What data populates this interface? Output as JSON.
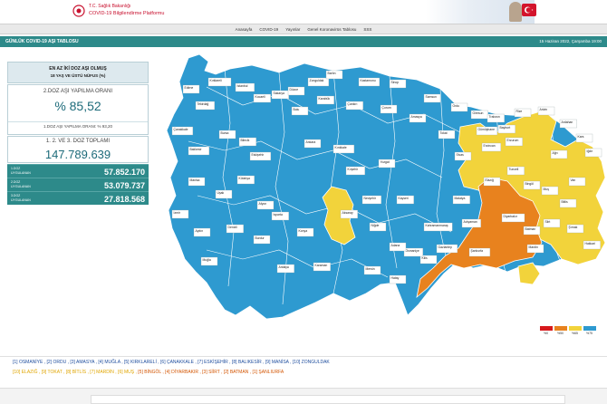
{
  "header": {
    "org_line1": "T.C. Sağlık Bakanlığı",
    "org_line2": "COVID-19 Bilgilendirme Platformu"
  },
  "nav": {
    "items": [
      "Anasayfa",
      "COVID-19",
      "Yayınlar",
      "Genel Koronavirüs Tablosu",
      "SSS"
    ]
  },
  "titlebar": {
    "title": "GÜNLÜK COVID-19 AŞI TABLOSU",
    "date": "15 Haziran 2022, Çarşamba 19:00"
  },
  "panel": {
    "top_line1": "EN AZ İKİ DOZ AŞI OLMUŞ",
    "top_line2": "18 YAŞ VE ÜSTÜ NÜFUS (%)",
    "rate_label": "2.DOZ AŞI YAPILMA ORANI",
    "rate_value": "% 85,52",
    "rate_sub": "1.DOZ AŞI YAPILMA ORANI: % 93,20",
    "total_label": "1. 2. VE 3. DOZ TOPLAMI",
    "total_value": "147.789.639",
    "doses": [
      {
        "l1": "1.DOZ",
        "l2": "UYGULANAN",
        "value": "57.852.170"
      },
      {
        "l1": "2.DOZ",
        "l2": "UYGULANAN",
        "value": "53.079.737"
      },
      {
        "l1": "3.DOZ",
        "l2": "UYGULANAN",
        "value": "27.818.568"
      }
    ]
  },
  "legend": {
    "labels": [
      "%0",
      "%50",
      "%65",
      "%75"
    ],
    "colors": [
      "#d7191c",
      "#e8821e",
      "#f2d33b",
      "#2e9ad0"
    ]
  },
  "colors": {
    "blue": "#2e9ad0",
    "yellow": "#f2d33b",
    "orange": "#e8821e",
    "teal": "#2d8a8a"
  },
  "notes": {
    "line1": "[1] OSMANİYE , [2] ORDU , [3] AMASYA , [4] MUĞLA , [5] KIRKLARELİ , [6] ÇANAKKALE , [7] ESKİŞEHİR , [8] BALIKESİR , [9] MANİSA , [10] ZONGULDAK",
    "line2_yellow": "[10] ELAZIĞ , [9] TOKAT , [8] BİTLİS , [7] MARDİN , [6] MUŞ , ",
    "line2_orange": "[5] BİNGÖL , [4] DİYARBAKIR , [3] SİİRT , [2] BATMAN , [1] ŞANLIURFA"
  },
  "map_labels": [
    "Edirne",
    "Kırklareli",
    "İstanbul",
    "Tekirdağ",
    "Kocaeli",
    "Sakarya",
    "Düzce",
    "Zonguldak",
    "Bartın",
    "Kastamonu",
    "Sinop",
    "Samsun",
    "Ordu",
    "Giresun",
    "Trabzon",
    "Rize",
    "Artvin",
    "Ardahan",
    "Kars",
    "Iğdır",
    "Erzurum",
    "Ağrı",
    "Van",
    "Çanakkale",
    "Balıkesir",
    "Bursa",
    "Bilecik",
    "Bolu",
    "Karabük",
    "Çankırı",
    "Çorum",
    "Amasya",
    "Tokat",
    "Sivas",
    "Erzincan",
    "Bayburt",
    "Gümüşhane",
    "Tunceli",
    "Bingöl",
    "Muş",
    "Bitlis",
    "Siirt",
    "Batman",
    "Şırnak",
    "Hakkari",
    "Mardin",
    "Diyarbakır",
    "Şanlıurfa",
    "Adıyaman",
    "Malatya",
    "Elazığ",
    "Kahramanmaraş",
    "Gaziantep",
    "Kilis",
    "Osmaniye",
    "Hatay",
    "Adana",
    "Mersin",
    "Karaman",
    "Konya",
    "Aksaray",
    "Niğde",
    "Kayseri",
    "Nevşehir",
    "Kırşehir",
    "Kırıkkale",
    "Ankara",
    "Eskişehir",
    "Kütahya",
    "Uşak",
    "Afyon",
    "Manisa",
    "İzmir",
    "Aydın",
    "Denizli",
    "Muğla",
    "Burdur",
    "Isparta",
    "Antalya",
    "Yozgat"
  ]
}
